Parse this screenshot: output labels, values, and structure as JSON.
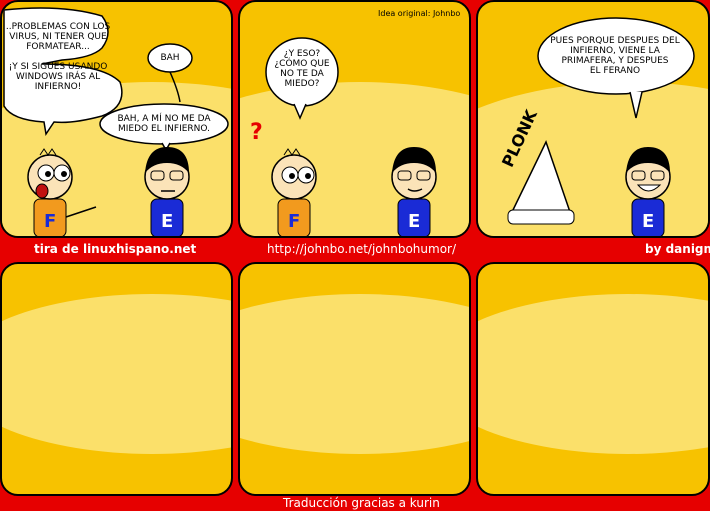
{
  "comic": {
    "credit_original": "Idea original: Johnbo",
    "footer": {
      "left": "tira de linuxhispano.net",
      "center": "http://johnbo.net/johnbohumor/",
      "right": "by danigm",
      "bottom": "Traducción gracias a kurin"
    },
    "panel1": {
      "bubble_a": "..Problemas con los\nvirus, ni tener que\nformatear...\n\n¡Y si sigues usando\nWindows irás al\ninfierno!",
      "bubble_b": "Bah",
      "bubble_c": "Bah, a mí no me da\nmiedo el infierno."
    },
    "panel2": {
      "bubble_a": "¿Y eso?\n¿Cómo que\nno te da\nmiedo?",
      "question_mark": "?"
    },
    "panel3": {
      "bubble_a": "Pues porque despues del\ninfierno, viene la\nprimafera, y despues\nel ferano",
      "sfx": "PLONK"
    },
    "colors": {
      "background": "#e60000",
      "panel_fill": "#f7c200",
      "panel_highlight": "#fbe06a",
      "f_shirt": "#f29a1e",
      "e_shirt": "#1a2bd6"
    }
  }
}
